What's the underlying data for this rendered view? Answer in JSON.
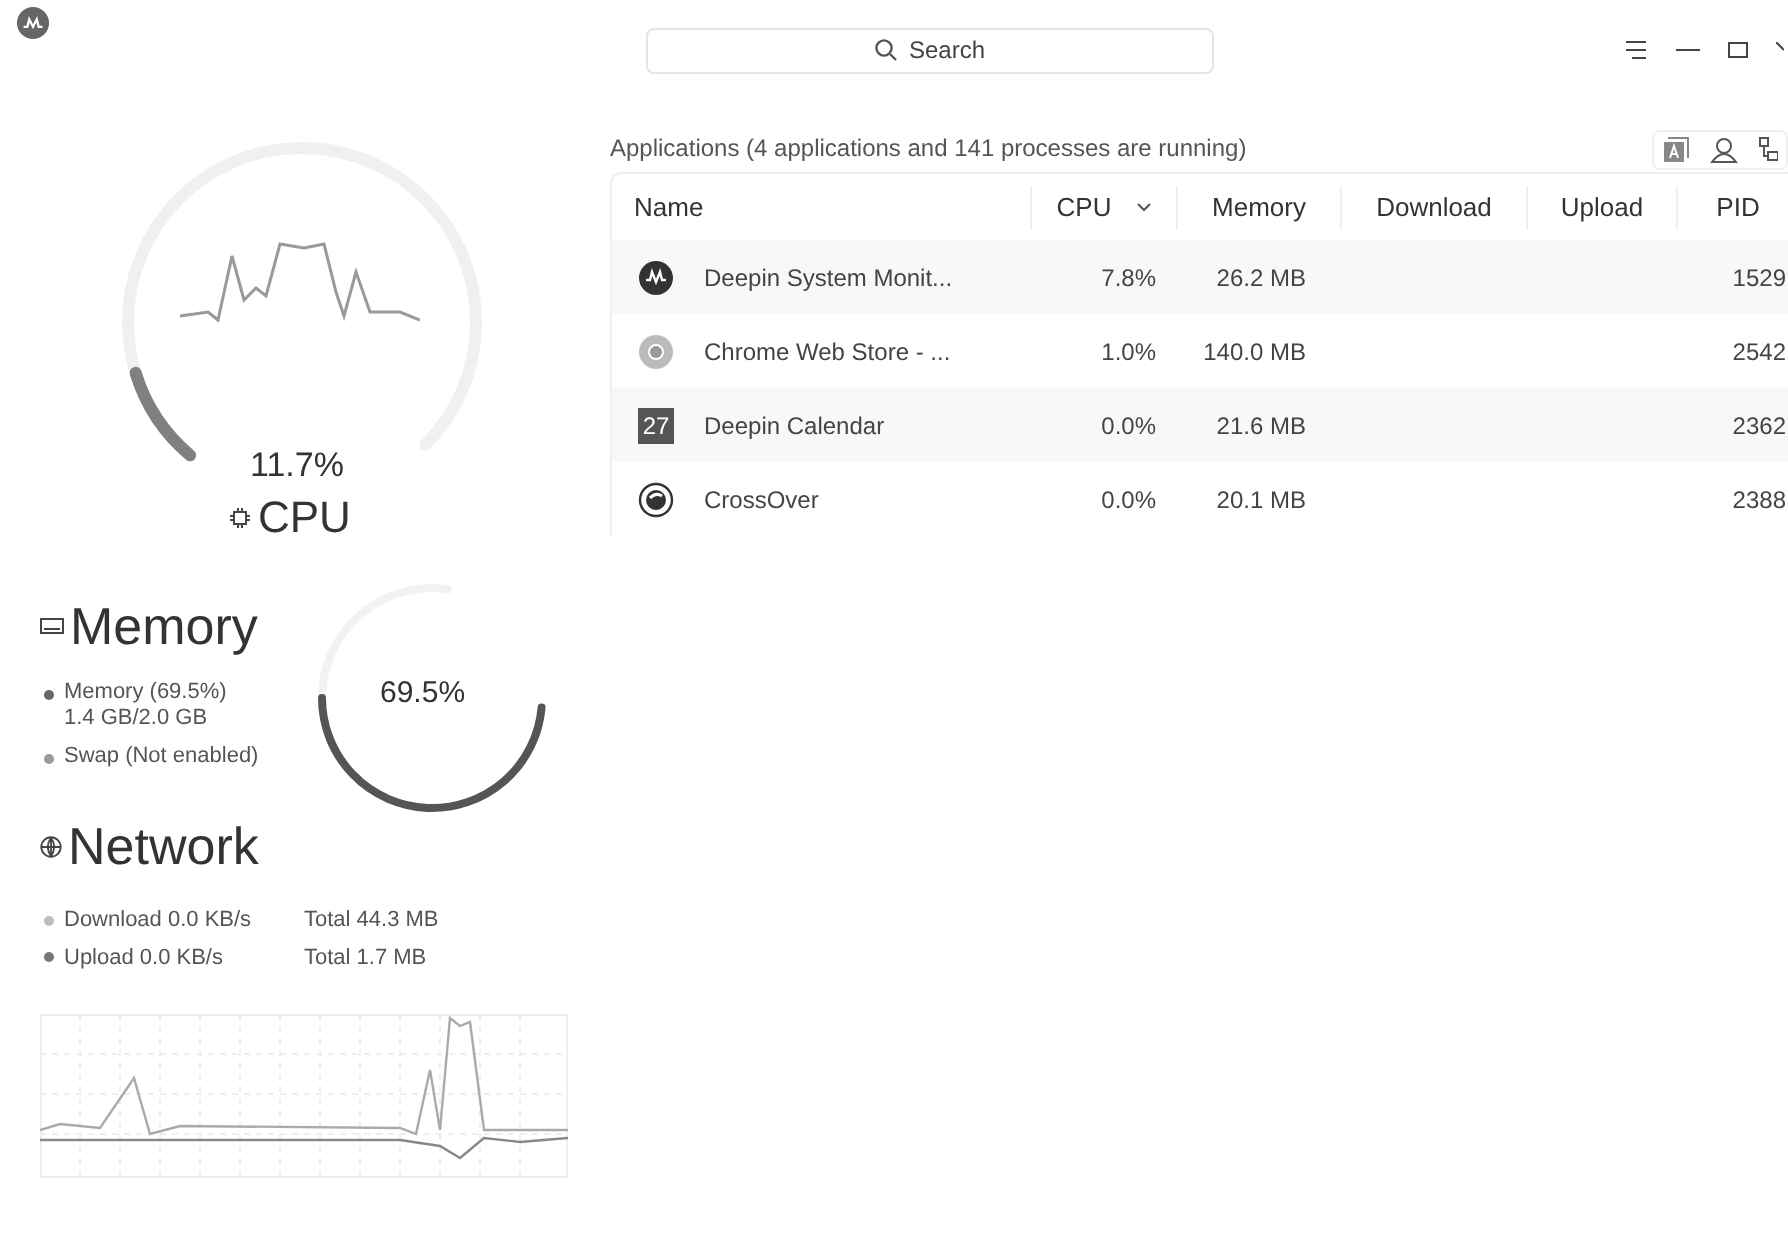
{
  "search": {
    "placeholder": "Search"
  },
  "cpu": {
    "reading": "11.7%",
    "title": "CPU"
  },
  "memory": {
    "title": "Memory",
    "reading": "69.5%",
    "items": [
      {
        "label": "Memory (69.5%)",
        "detail": "1.4 GB/2.0 GB",
        "color": "#666666"
      },
      {
        "label": "Swap (Not enabled)",
        "color": "#9a9a9a"
      }
    ]
  },
  "network": {
    "title": "Network",
    "items": [
      {
        "label": "Download 0.0 KB/s",
        "total": "Total 44.3 MB",
        "color": "#bdbdbd"
      },
      {
        "label": "Upload 0.0 KB/s",
        "total": "Total 1.7 MB",
        "color": "#777777"
      }
    ]
  },
  "summary": "Applications (4 applications and 141 processes are running)",
  "columns": [
    {
      "label": "Name",
      "sorted": false
    },
    {
      "label": "CPU",
      "sorted": true
    },
    {
      "label": "Memory",
      "sorted": false
    },
    {
      "label": "Download",
      "sorted": false
    },
    {
      "label": "Upload",
      "sorted": false
    },
    {
      "label": "PID",
      "sorted": false
    }
  ],
  "rows": [
    {
      "name": "Deepin System Monit...",
      "cpu": "7.8%",
      "memory": "26.2 MB",
      "pid": "1529"
    },
    {
      "name": "Chrome Web Store - ...",
      "cpu": "1.0%",
      "memory": "140.0 MB",
      "pid": "2542"
    },
    {
      "name": "Deepin Calendar",
      "icon_text": "27",
      "cpu": "0.0%",
      "memory": "21.6 MB",
      "pid": "2362"
    },
    {
      "name": "CrossOver",
      "cpu": "0.0%",
      "memory": "20.1 MB",
      "pid": "2388"
    }
  ]
}
